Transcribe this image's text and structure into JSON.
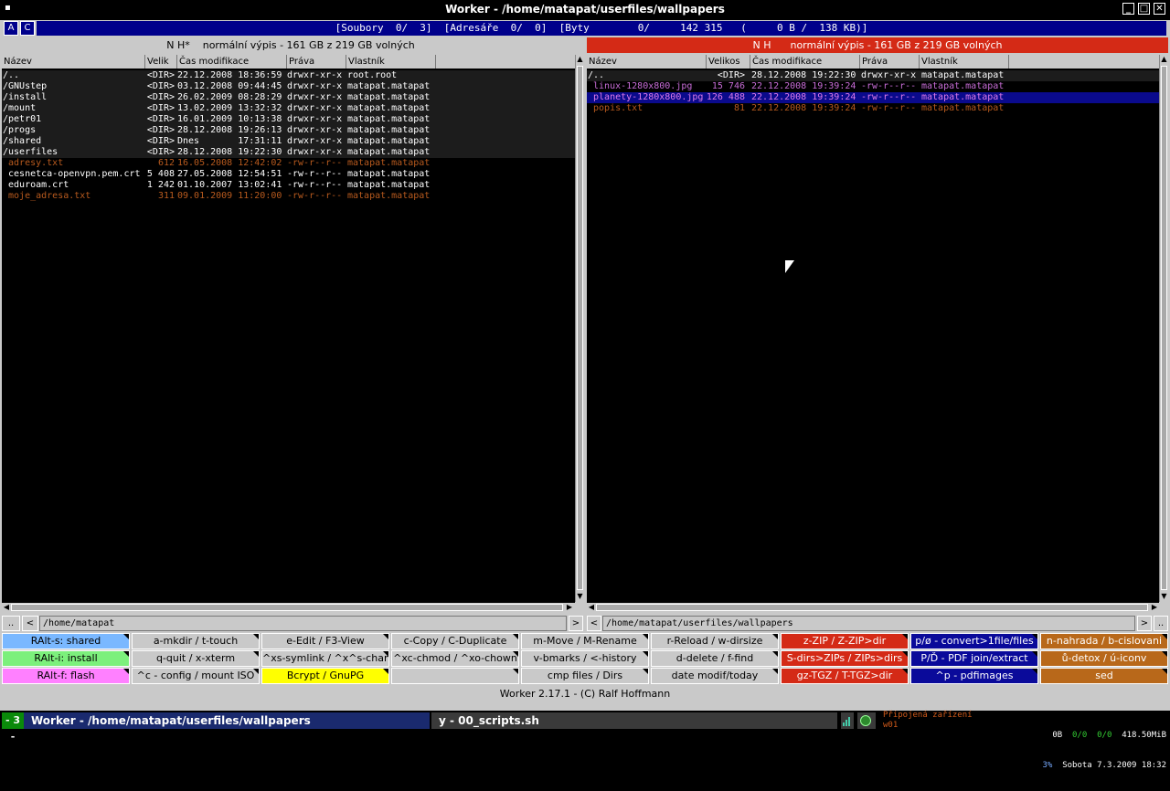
{
  "window": {
    "title": "Worker - /home/matapat/userfiles/wallpapers",
    "menu_glyph": "▪",
    "min_glyph": "_",
    "max_glyph": "□",
    "close_glyph": "✕"
  },
  "statusbar": {
    "btn_a": "A",
    "btn_c": "C",
    "info": "[Soubory  0/  3]  [Adresáře  0/  0]  [Byty        0/     142 315   (     0 B /  138 KB)]"
  },
  "left": {
    "header": "N H*    normální výpis - 161 GB z 219 GB volných",
    "columns": [
      "Název",
      "Velik",
      "Čas modifikace",
      "Práva",
      "Vlastník"
    ],
    "rows": [
      {
        "name": "/..",
        "size": "<DIR>",
        "time": "22.12.2008 18:36:59",
        "perm": "drwxr-xr-x",
        "owner": "root.root",
        "color": "#ffffff",
        "bg": "#1c1c1c"
      },
      {
        "name": "/GNUstep",
        "size": "<DIR>",
        "time": "03.12.2008 09:44:45",
        "perm": "drwxr-xr-x",
        "owner": "matapat.matapat",
        "color": "#ffffff",
        "bg": "#1c1c1c"
      },
      {
        "name": "/install",
        "size": "<DIR>",
        "time": "26.02.2009 08:28:29",
        "perm": "drwxr-xr-x",
        "owner": "matapat.matapat",
        "color": "#ffffff",
        "bg": "#1c1c1c"
      },
      {
        "name": "/mount",
        "size": "<DIR>",
        "time": "13.02.2009 13:32:32",
        "perm": "drwxr-xr-x",
        "owner": "matapat.matapat",
        "color": "#ffffff",
        "bg": "#1c1c1c"
      },
      {
        "name": "/petr01",
        "size": "<DIR>",
        "time": "16.01.2009 10:13:38",
        "perm": "drwxr-xr-x",
        "owner": "matapat.matapat",
        "color": "#ffffff",
        "bg": "#1c1c1c"
      },
      {
        "name": "/progs",
        "size": "<DIR>",
        "time": "28.12.2008 19:26:13",
        "perm": "drwxr-xr-x",
        "owner": "matapat.matapat",
        "color": "#ffffff",
        "bg": "#1c1c1c"
      },
      {
        "name": "/shared",
        "size": "<DIR>",
        "time": "Dnes       17:31:11",
        "perm": "drwxr-xr-x",
        "owner": "matapat.matapat",
        "color": "#ffffff",
        "bg": "#1c1c1c"
      },
      {
        "name": "/userfiles",
        "size": "<DIR>",
        "time": "28.12.2008 19:22:30",
        "perm": "drwxr-xr-x",
        "owner": "matapat.matapat",
        "color": "#ffffff",
        "bg": "#1c1c1c"
      },
      {
        "name": " adresy.txt",
        "size": "612",
        "time": "16.05.2008 12:42:02",
        "perm": "-rw-r--r--",
        "owner": "matapat.matapat",
        "color": "#b85a1e",
        "bg": "#000000"
      },
      {
        "name": " cesnetca-openvpn.pem.crt",
        "size": "5 408",
        "time": "27.05.2008 12:54:51",
        "perm": "-rw-r--r--",
        "owner": "matapat.matapat",
        "color": "#ffffff",
        "bg": "#000000"
      },
      {
        "name": " eduroam.crt",
        "size": "1 242",
        "time": "01.10.2007 13:02:41",
        "perm": "-rw-r--r--",
        "owner": "matapat.matapat",
        "color": "#ffffff",
        "bg": "#000000"
      },
      {
        "name": " moje_adresa.txt",
        "size": "311",
        "time": "09.01.2009 11:20:00",
        "perm": "-rw-r--r--",
        "owner": "matapat.matapat",
        "color": "#b85a1e",
        "bg": "#000000"
      }
    ],
    "path": "/home/matapat",
    "nav_up": "..",
    "nav_back": "<",
    "nav_fwd": ">"
  },
  "right": {
    "header": "N H      normální výpis - 161 GB z 219 GB volných",
    "columns": [
      "Název",
      "Velikos",
      "Čas modifikace",
      "Práva",
      "Vlastník"
    ],
    "rows": [
      {
        "name": "/..",
        "size": "<DIR>",
        "time": "28.12.2008 19:22:30",
        "perm": "drwxr-xr-x",
        "owner": "matapat.matapat",
        "color": "#ffffff",
        "bg": "#1c1c1c"
      },
      {
        "name": " linux-1280x800.jpg",
        "size": "15 746",
        "time": "22.12.2008 19:39:24",
        "perm": "-rw-r--r--",
        "owner": "matapat.matapat",
        "color": "#c86dd7",
        "bg": "#000000"
      },
      {
        "name": " planety-1280x800.jpg",
        "size": "126 488",
        "time": "22.12.2008 19:39:24",
        "perm": "-rw-r--r--",
        "owner": "matapat.matapat",
        "color": "#e07be8",
        "bg": "#0a0a8c"
      },
      {
        "name": " popis.txt",
        "size": "81",
        "time": "22.12.2008 19:39:24",
        "perm": "-rw-r--r--",
        "owner": "matapat.matapat",
        "color": "#b85a1e",
        "bg": "#000000"
      }
    ],
    "path": "/home/matapat/userfiles/wallpapers",
    "nav_up": "..",
    "nav_back": "<",
    "nav_fwd": ">"
  },
  "buttons": [
    [
      {
        "label": "RAlt-s: shared",
        "bg": "#7ab8ff",
        "fg": "#000"
      },
      {
        "label": "a-mkdir / t-touch",
        "bg": "#c9c9c9",
        "fg": "#000"
      },
      {
        "label": "e-Edit / F3-View",
        "bg": "#c9c9c9",
        "fg": "#000"
      },
      {
        "label": "c-Copy / C-Duplicate",
        "bg": "#c9c9c9",
        "fg": "#000"
      },
      {
        "label": "m-Move / M-Rename",
        "bg": "#c9c9c9",
        "fg": "#000"
      },
      {
        "label": "r-Reload / w-dirsize",
        "bg": "#c9c9c9",
        "fg": "#000"
      },
      {
        "label": "z-ZIP / Z-ZIP>dir",
        "bg": "#d42a16",
        "fg": "#fff"
      },
      {
        "label": "p/ø - convert>1file/files",
        "bg": "#0a0a9a",
        "fg": "#fff"
      },
      {
        "label": "n-nahrada / b-cislovani",
        "bg": "#b8681a",
        "fg": "#fff"
      }
    ],
    [
      {
        "label": "RAlt-i: install",
        "bg": "#7cf07c",
        "fg": "#000"
      },
      {
        "label": "q-quit / x-xterm",
        "bg": "#c9c9c9",
        "fg": "#000"
      },
      {
        "label": "^xs-symlink / ^x^s-chang",
        "bg": "#c9c9c9",
        "fg": "#000"
      },
      {
        "label": "^xc-chmod / ^xo-chown",
        "bg": "#c9c9c9",
        "fg": "#000"
      },
      {
        "label": "v-bmarks / <-history",
        "bg": "#c9c9c9",
        "fg": "#000"
      },
      {
        "label": "d-delete / f-find",
        "bg": "#c9c9c9",
        "fg": "#000"
      },
      {
        "label": "S-dirs>ZIPs / ZIPs>dirs",
        "bg": "#d42a16",
        "fg": "#fff"
      },
      {
        "label": "P/Ď - PDF join/extract",
        "bg": "#0a0a9a",
        "fg": "#fff"
      },
      {
        "label": "ů-detox / ú-iconv",
        "bg": "#b8681a",
        "fg": "#fff"
      }
    ],
    [
      {
        "label": "RAlt-f: flash",
        "bg": "#ff80ff",
        "fg": "#000"
      },
      {
        "label": "^c - config / mount ISO",
        "bg": "#c9c9c9",
        "fg": "#000"
      },
      {
        "label": "Bcrypt / GnuPG",
        "bg": "#ffff00",
        "fg": "#000"
      },
      {
        "label": "",
        "bg": "#c9c9c9",
        "fg": "#000"
      },
      {
        "label": "cmp files / Dirs",
        "bg": "#c9c9c9",
        "fg": "#000"
      },
      {
        "label": "date modif/today",
        "bg": "#c9c9c9",
        "fg": "#000"
      },
      {
        "label": "gz-TGZ / T-TGZ>dir",
        "bg": "#d42a16",
        "fg": "#fff"
      },
      {
        "label": "^p - pdfimages",
        "bg": "#0a0a9a",
        "fg": "#fff"
      },
      {
        "label": "sed",
        "bg": "#b8681a",
        "fg": "#fff"
      }
    ]
  ],
  "footer": "Worker 2.17.1 - (C) Ralf Hoffmann",
  "taskbar": {
    "desktop": "- 3 -",
    "task1": "Worker - /home/matapat/userfiles/wallpapers",
    "task2": "y - 00_scripts.sh",
    "devices_label": "Připojená zařízení",
    "device": "w01",
    "net_a": "0B",
    "net_b": "0/0",
    "net_c": "0/0",
    "mem": "418.50MiB",
    "cpu": "3%",
    "datetime": "Sobota 7.3.2009 18:32"
  }
}
